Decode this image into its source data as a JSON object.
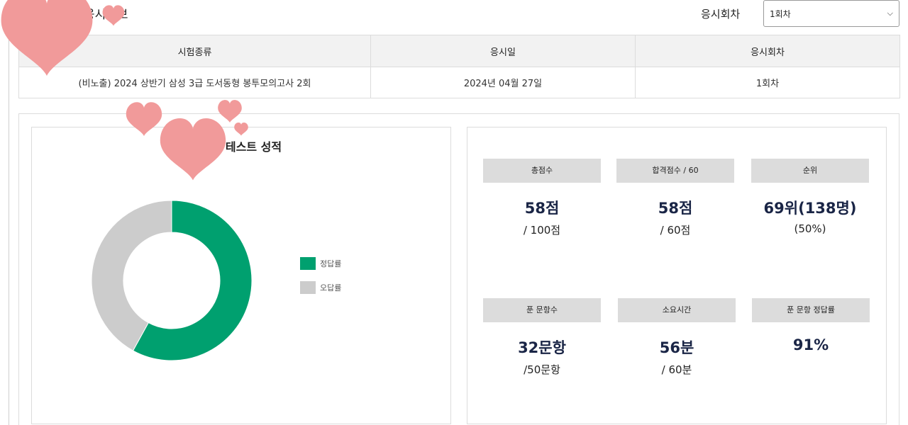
{
  "header": {
    "section_title": "응시정보",
    "round_label": "응시회차",
    "round_selected": "1회차"
  },
  "info_table": {
    "columns": [
      "시험종류",
      "응시일",
      "응시회차"
    ],
    "row": [
      "(비노출) 2024 상반기 삼성 3급 도서동형 봉투모의고사 2회",
      "2024년 04월 27일",
      "1회차"
    ]
  },
  "chart_title": "모의 테스트 성적",
  "chart_data": {
    "type": "pie",
    "donut": true,
    "categories": [
      "정답률",
      "오답률"
    ],
    "values": [
      58,
      42
    ],
    "colors": [
      "#00a06f",
      "#cccccc"
    ],
    "legend_position": "right"
  },
  "stats": [
    {
      "label": "총점수",
      "value": "58점",
      "sub": "/ 100점"
    },
    {
      "label": "합격점수 / 60",
      "value": "58점",
      "sub": "/ 60점"
    },
    {
      "label": "순위",
      "value": "69위(138명)",
      "sub": "(50%)"
    },
    {
      "label": "푼 문항수",
      "value": "32문항",
      "sub": "/50문항"
    },
    {
      "label": "소요시간",
      "value": "56분",
      "sub": "/ 60분"
    },
    {
      "label": "푼 문항 정답률",
      "value": "91%",
      "sub": ""
    }
  ],
  "colors": {
    "accent_green": "#00a06f",
    "wrong_gray": "#cccccc",
    "stat_value": "#1a2546",
    "heart": "#f19a9a"
  }
}
